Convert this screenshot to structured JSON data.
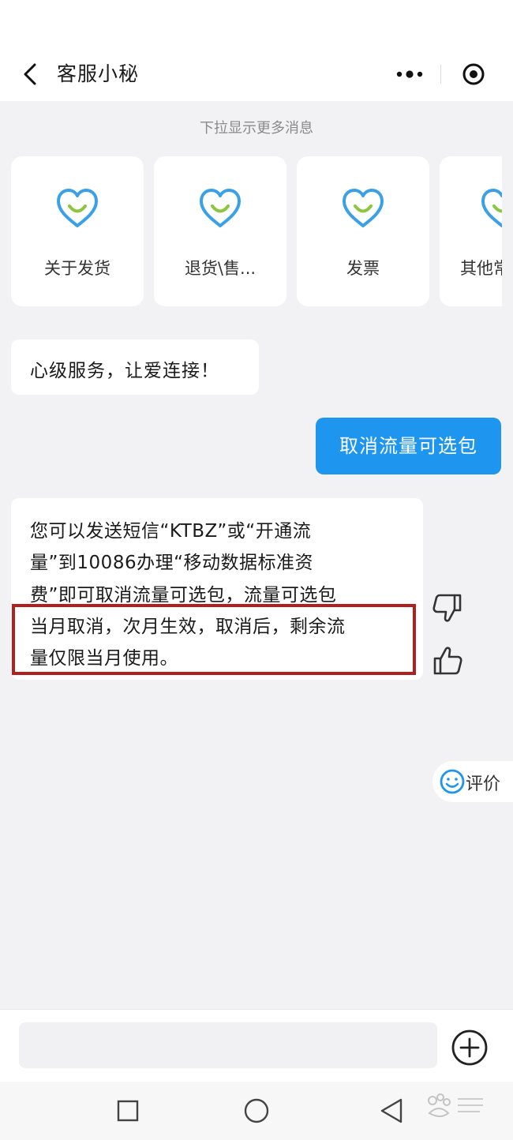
{
  "header": {
    "title": "客服小秘"
  },
  "chat": {
    "pull_hint": "下拉显示更多消息",
    "quick_topics": [
      {
        "label": "关于发货",
        "icon": "heart-smile-icon"
      },
      {
        "label": "退货\\售...",
        "icon": "heart-smile-icon"
      },
      {
        "label": "发票",
        "icon": "heart-smile-icon"
      },
      {
        "label": "其他常",
        "icon": "heart-smile-icon"
      }
    ],
    "messages": {
      "welcome": "心级服务，让爱连接！",
      "user_query": "取消流量可选包",
      "reply_lines": [
        "您可以发送短信“KTBZ”或“开通流",
        "量”到10086办理“移动数据标准资",
        "费”即可取消流量可选包，流量可选包",
        "当月取消，次月生效，取消后，剩余流",
        "量仅限当月使用。"
      ]
    },
    "rate_label": "评价"
  },
  "input": {
    "placeholder": ""
  },
  "colors": {
    "accent_blue": "#1e96f0",
    "heart_blue": "#3aa0e8",
    "smile_green": "#8cc63f",
    "highlight_red": "#b0201e"
  }
}
